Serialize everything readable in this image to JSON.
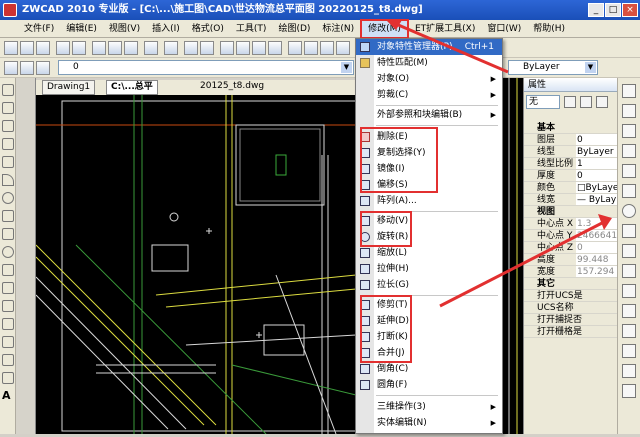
{
  "window": {
    "title": "ZWCAD 2010 专业版 - [C:\\...\\施工图\\CAD\\世达物流总平面图 20220125_t8.dwg]",
    "controls": [
      "_",
      "□",
      "×"
    ]
  },
  "menubar": {
    "items": [
      {
        "label": "文件(F)"
      },
      {
        "label": "编辑(E)"
      },
      {
        "label": "视图(V)"
      },
      {
        "label": "插入(I)"
      },
      {
        "label": "格式(O)"
      },
      {
        "label": "工具(T)"
      },
      {
        "label": "绘图(D)"
      },
      {
        "label": "标注(N)"
      },
      {
        "label": "修改(M)",
        "active": true
      },
      {
        "label": "ET扩展工具(X)"
      },
      {
        "label": "窗口(W)"
      },
      {
        "label": "帮助(H)"
      }
    ]
  },
  "toolbar2": {
    "layer_value": "0",
    "color_value": "ByLayer",
    "linetype_value": "ByLayer"
  },
  "doc_tabs": [
    {
      "label": "Drawing1"
    },
    {
      "label": "C:\\...总平"
    },
    {
      "label": "20125_t8.dwg"
    }
  ],
  "dropdown": {
    "items": [
      {
        "label": "对象特性管理器(P)",
        "shortcut": "Ctrl+1",
        "icon": "properties-icon"
      },
      {
        "label": "特性匹配(M)",
        "icon": "match-brush-icon"
      },
      {
        "label": "对象(O)",
        "submenu": true
      },
      {
        "label": "剪裁(C)",
        "submenu": true
      },
      {
        "sep": true
      },
      {
        "label": "外部参照和块编辑(B)",
        "submenu": true
      },
      {
        "sep": true
      },
      {
        "label": "删除(E)",
        "icon": "erase-icon"
      },
      {
        "label": "复制选择(Y)",
        "icon": "copy-icon"
      },
      {
        "label": "镜像(I)",
        "icon": "mirror-icon"
      },
      {
        "label": "偏移(S)",
        "icon": "offset-icon"
      },
      {
        "label": "阵列(A)...",
        "icon": "array-icon"
      },
      {
        "sep": true
      },
      {
        "label": "移动(V)",
        "icon": "move-icon"
      },
      {
        "label": "旋转(R)",
        "icon": "rotate-icon"
      },
      {
        "label": "缩放(L)",
        "icon": "scale-icon"
      },
      {
        "label": "拉伸(H)",
        "icon": "stretch-icon"
      },
      {
        "label": "拉长(G)",
        "icon": "lengthen-icon"
      },
      {
        "sep": true
      },
      {
        "label": "修剪(T)",
        "icon": "trim-icon"
      },
      {
        "label": "延伸(D)",
        "icon": "extend-icon"
      },
      {
        "label": "打断(K)",
        "icon": "break-icon"
      },
      {
        "label": "合并(J)",
        "icon": "join-icon"
      },
      {
        "label": "倒角(C)",
        "icon": "chamfer-icon"
      },
      {
        "label": "圆角(F)",
        "icon": "fillet-icon"
      },
      {
        "sep": true
      },
      {
        "label": "三维操作(3)",
        "submenu": true
      },
      {
        "label": "实体编辑(N)",
        "submenu": true
      }
    ]
  },
  "properties": {
    "title": "属性",
    "selection": "无",
    "rows": [
      {
        "group": "基本"
      },
      {
        "key": "图层",
        "value": "0"
      },
      {
        "key": "线型",
        "value": "ByLayer"
      },
      {
        "key": "线型比例",
        "value": "1"
      },
      {
        "key": "厚度",
        "value": "0"
      },
      {
        "key": "颜色",
        "value": "□ByLaye"
      },
      {
        "key": "线宽",
        "value": "— ByLay"
      },
      {
        "group": "视图"
      },
      {
        "key": "中心点 X",
        "value": "1.3"
      },
      {
        "key": "中心点 Y",
        "value": "2466641.0"
      },
      {
        "key": "中心点 Z",
        "value": "0"
      },
      {
        "key": "高度",
        "value": "99.448"
      },
      {
        "key": "宽度",
        "value": "157.294"
      },
      {
        "group": "其它"
      },
      {
        "key": "打开UCS是",
        "value": ""
      },
      {
        "key": "UCS名称",
        "value": ""
      },
      {
        "key": "打开捕捉否",
        "value": ""
      },
      {
        "key": "打开栅格是",
        "value": ""
      }
    ]
  },
  "colors": {
    "highlight": "#e23030",
    "titlebar": "#1a4fb8",
    "canvas": "#000000"
  }
}
